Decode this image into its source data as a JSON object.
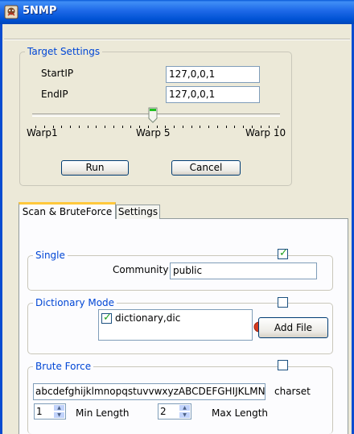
{
  "window": {
    "title": "5NMP",
    "icon": "app-icon"
  },
  "target_settings": {
    "legend": "Target Settings",
    "start_ip_label": "StartIP",
    "start_ip_value": "127,0,0,1",
    "end_ip_label": "EndIP",
    "end_ip_value": "127,0,0,1",
    "speed": {
      "min_label": "Warp1",
      "mid_label": "Warp 5",
      "max_label": "Warp 10",
      "value": 5,
      "min": 1,
      "max": 10
    },
    "run_label": "Run",
    "cancel_label": "Cancel"
  },
  "tabs": [
    {
      "label": "Scan & BruteForce",
      "active": true
    },
    {
      "label": "Settings",
      "active": false
    }
  ],
  "single": {
    "legend": "Single",
    "enabled": true,
    "community_label": "Community",
    "community_value": "public"
  },
  "dictionary": {
    "legend": "Dictionary Mode",
    "enabled": false,
    "files": [
      {
        "name": "dictionary,dic",
        "checked": true
      }
    ],
    "add_file_label": "Add File"
  },
  "brute_force": {
    "legend": "Brute Force",
    "enabled": false,
    "charset_value": "abcdefghijklmnopqstuvvwxyzABCDEFGHIJKLMNO",
    "charset_label": "charset",
    "min_length_value": "1",
    "min_length_label": "Min Length",
    "max_length_value": "2",
    "max_length_label": "Max Length"
  },
  "colors": {
    "accent": "#0046d5",
    "title_bar": "#0a5ad8",
    "check": "#21a121",
    "warning": "#d73a1e"
  }
}
